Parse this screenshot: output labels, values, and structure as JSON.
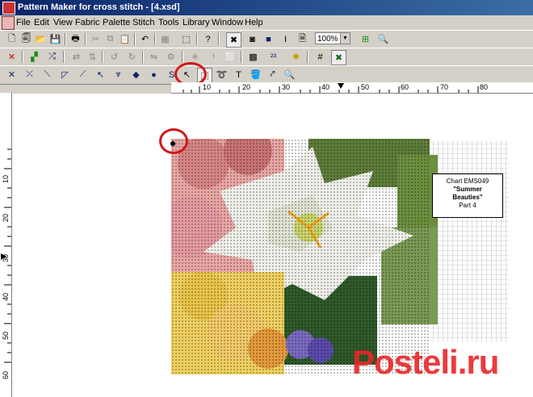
{
  "window": {
    "title": "Pattern Maker for cross stitch - [4.xsd]"
  },
  "menu": [
    "File",
    "Edit",
    "View",
    "Fabric",
    "Palette",
    "Stitch",
    "Tools",
    "Library",
    "Window",
    "Help"
  ],
  "toolbar": {
    "zoom_value": "100%"
  },
  "ruler": {
    "horizontal_labels": [
      "10",
      "20",
      "30",
      "40",
      "50",
      "60",
      "70",
      "80"
    ],
    "vertical_labels": [
      "10",
      "20",
      "30",
      "40",
      "50",
      "60"
    ]
  },
  "chart_label": {
    "line1": "Chart EMS049",
    "line2": "\"Summer",
    "line3": "Beauties\"",
    "line4": "Part 4"
  },
  "watermark": {
    "text": "Posteli.ru"
  },
  "colors": {
    "titlebar_start": "#0a246a",
    "titlebar_end": "#3a6ea5",
    "annotation_red": "#d01818"
  }
}
